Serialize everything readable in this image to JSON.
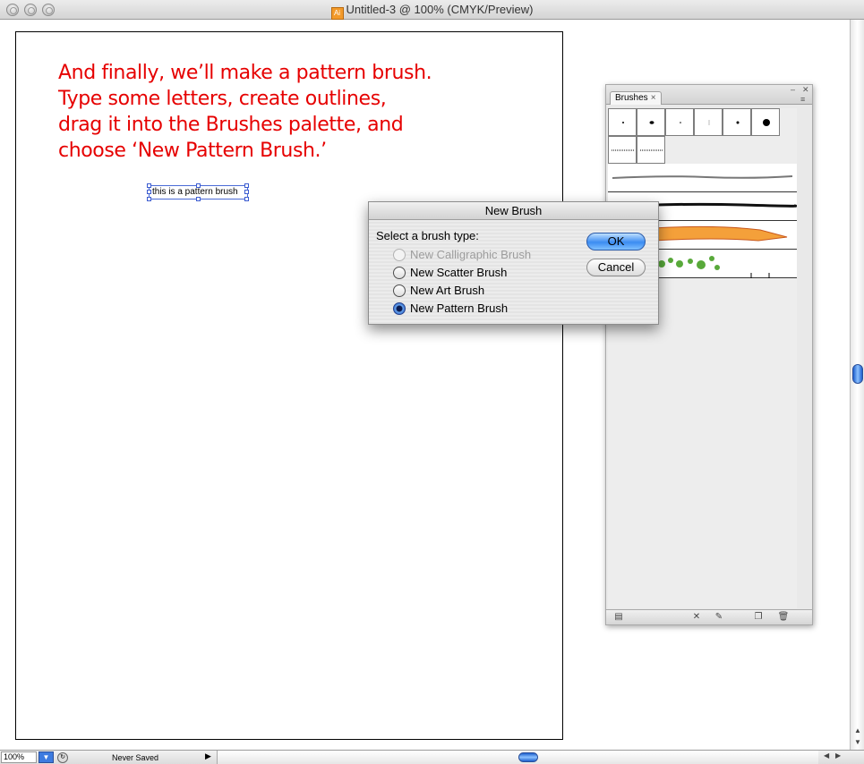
{
  "window": {
    "title": "Untitled-3 @ 100% (CMYK/Preview)",
    "file_icon": "illustrator-document-icon"
  },
  "artboard": {
    "instruction": "And finally, we’ll make a pattern brush. Type some letters, create outlines, drag it into the Brushes palette, and choose ‘New Pattern Brush.’",
    "selected_text": "this is a pattern brush"
  },
  "brushes_palette": {
    "tab_label": "Brushes",
    "tab_close": "×",
    "menu_icon": "palette-menu-icon",
    "collapse_icon": "collapse-icon",
    "close_icon": "close-icon"
  },
  "dialog": {
    "title": "New Brush",
    "prompt": "Select a brush type:",
    "options": [
      {
        "label": "New Calligraphic Brush",
        "disabled": true,
        "checked": false
      },
      {
        "label": "New Scatter Brush",
        "disabled": false,
        "checked": false
      },
      {
        "label": "New Art Brush",
        "disabled": false,
        "checked": false
      },
      {
        "label": "New Pattern Brush",
        "disabled": false,
        "checked": true
      }
    ],
    "ok_label": "OK",
    "cancel_label": "Cancel"
  },
  "statusbar": {
    "zoom": "100%",
    "status": "Never Saved"
  },
  "colors": {
    "instruction_text": "#e60000",
    "selection": "#3b5bd0",
    "aqua_blue": "#3b8cf2"
  }
}
